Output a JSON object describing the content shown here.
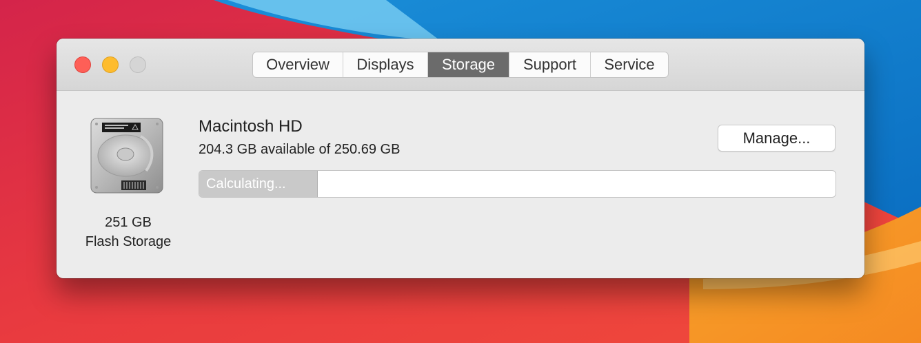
{
  "window": {
    "tabs": [
      {
        "label": "Overview",
        "active": false
      },
      {
        "label": "Displays",
        "active": false
      },
      {
        "label": "Storage",
        "active": true
      },
      {
        "label": "Support",
        "active": false
      },
      {
        "label": "Service",
        "active": false
      }
    ]
  },
  "storage": {
    "disk_size": "251 GB",
    "disk_type": "Flash Storage",
    "volume_name": "Macintosh HD",
    "availability": "204.3 GB available of 250.69 GB",
    "manage_label": "Manage...",
    "bar_segment_label": "Calculating..."
  },
  "colors": {
    "close": "#fe5f57",
    "minimize": "#febc2e",
    "zoom_disabled": "#d5d5d5",
    "active_tab": "#6b6b6b",
    "calculating_segment": "#c9c9c9"
  },
  "icons": {
    "disk": "internal-drive-icon"
  }
}
